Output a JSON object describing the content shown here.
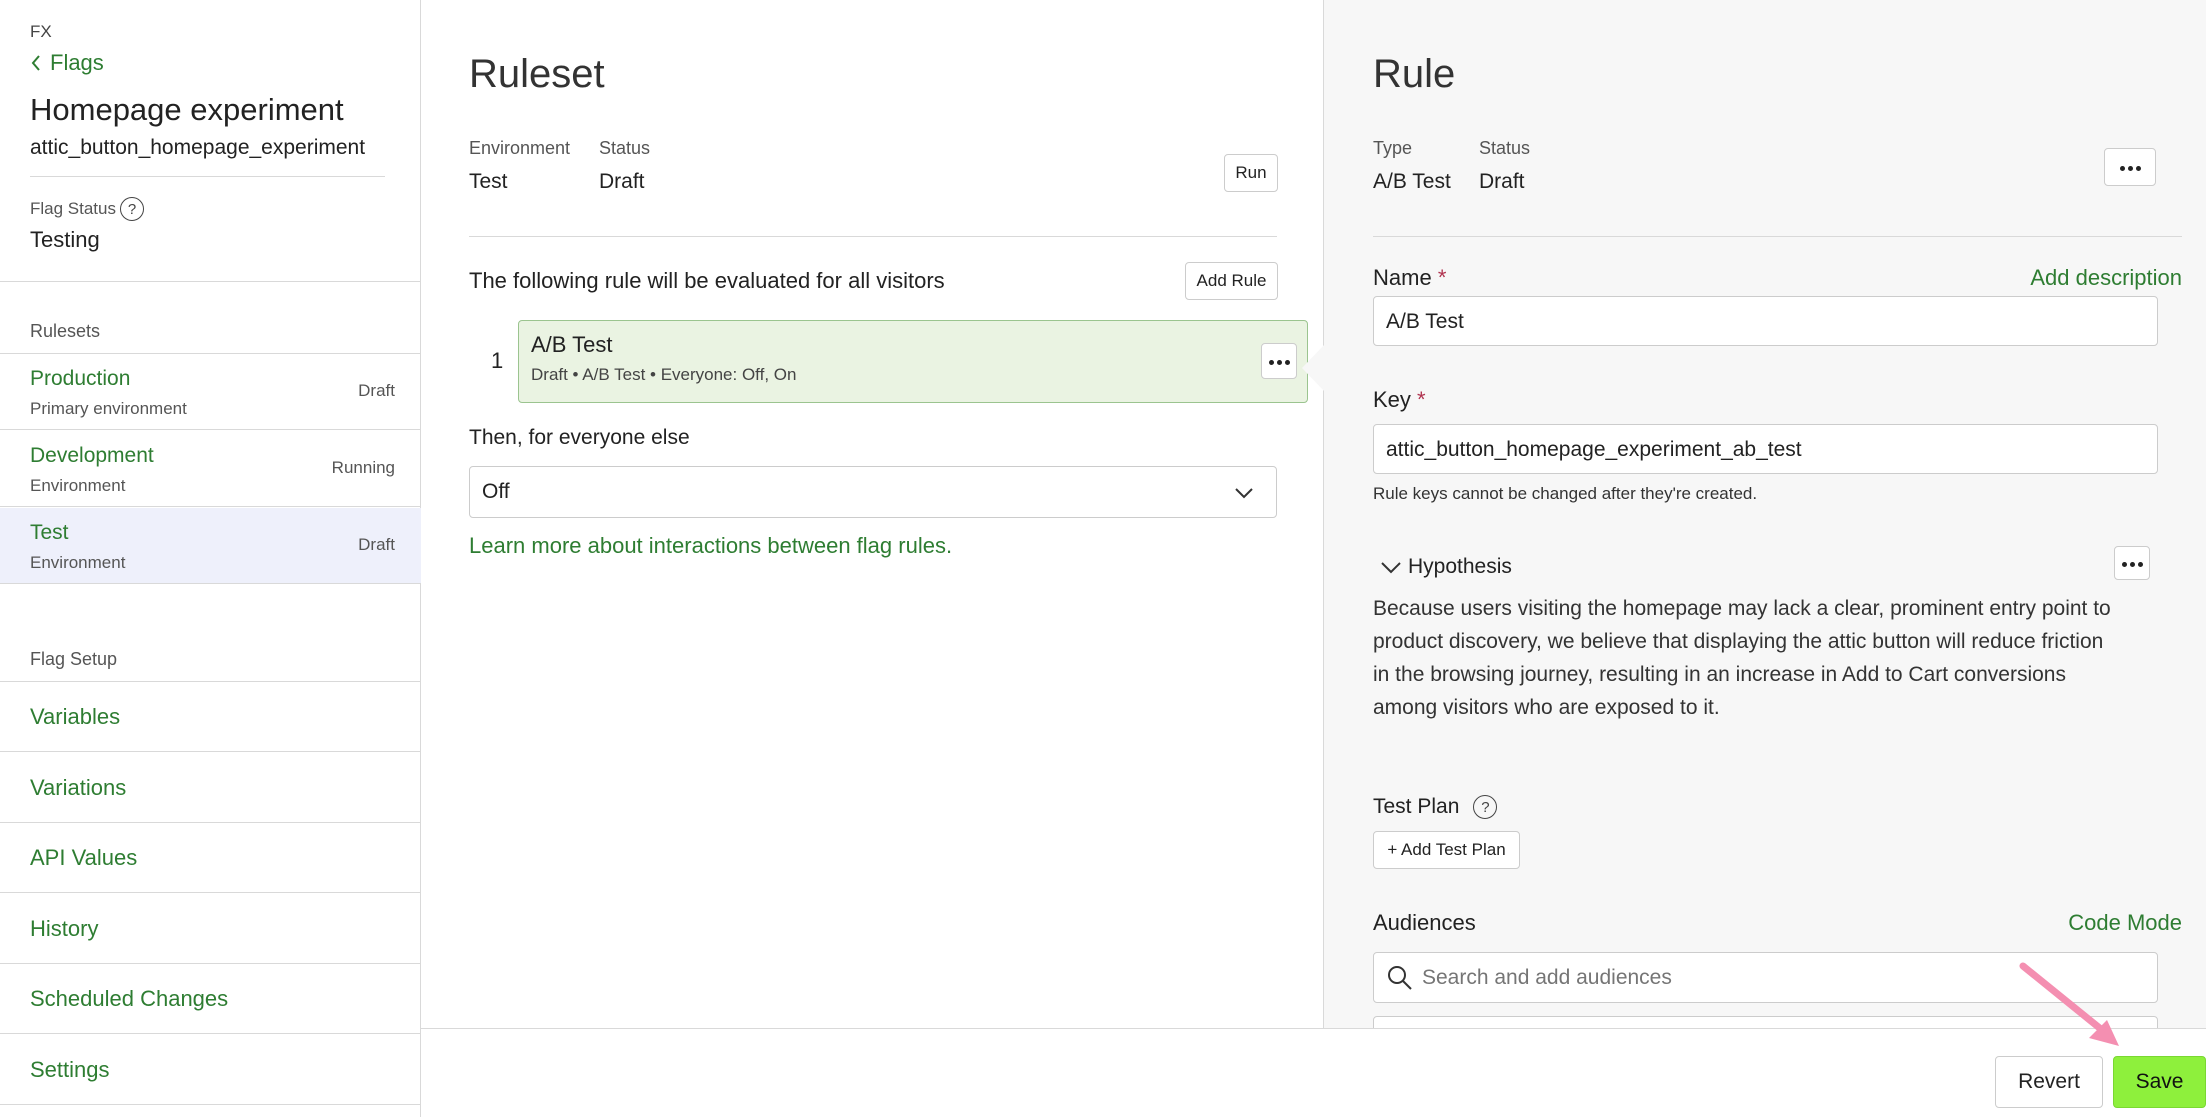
{
  "sidebar": {
    "crumb": "FX",
    "back_label": "Flags",
    "flag_title": "Homepage experiment",
    "flag_key": "attic_button_homepage_experiment",
    "flag_status_label": "Flag Status",
    "flag_status_value": "Testing",
    "rulesets_heading": "Rulesets",
    "rulesets": [
      {
        "name": "Production",
        "sub": "Primary environment",
        "status": "Draft"
      },
      {
        "name": "Development",
        "sub": "Environment",
        "status": "Running"
      },
      {
        "name": "Test",
        "sub": "Environment",
        "status": "Draft"
      }
    ],
    "setup_heading": "Flag Setup",
    "setup_items": [
      "Variables",
      "Variations",
      "API Values",
      "History",
      "Scheduled Changes",
      "Settings"
    ]
  },
  "ruleset": {
    "title": "Ruleset",
    "environment_label": "Environment",
    "environment_value": "Test",
    "status_label": "Status",
    "status_value": "Draft",
    "run_label": "Run",
    "evaluation_text": "The following rule will be evaluated for all visitors",
    "add_rule_label": "Add Rule",
    "rule_index": "1",
    "rule_title": "A/B Test",
    "rule_sub": "Draft • A/B Test • Everyone: Off, On",
    "else_label": "Then, for everyone else",
    "else_value": "Off",
    "learn_more": "Learn more about interactions between flag rules."
  },
  "rule": {
    "title": "Rule",
    "type_label": "Type",
    "type_value": "A/B Test",
    "status_label": "Status",
    "status_value": "Draft",
    "name_label": "Name",
    "required_mark": "*",
    "add_description": "Add description",
    "name_value": "A/B Test",
    "key_label": "Key",
    "key_value": "attic_button_homepage_experiment_ab_test",
    "key_hint": "Rule keys cannot be changed after they're created.",
    "hypothesis_label": "Hypothesis",
    "hypothesis_text": "Because users visiting the homepage may lack a clear, prominent entry point to product discovery, we believe that displaying the attic button will reduce friction in the browsing journey, resulting in an increase in Add to Cart conversions among visitors who are exposed to it.",
    "test_plan_label": "Test Plan",
    "add_test_plan_label": "+ Add Test Plan",
    "audiences_label": "Audiences",
    "code_mode_label": "Code Mode",
    "audience_search_placeholder": "Search and add audiences"
  },
  "footer": {
    "revert_label": "Revert",
    "save_label": "Save"
  },
  "help_glyph": "?",
  "colors": {
    "accent_green": "#2e7d32",
    "save_green": "#8ef03c",
    "active_row": "#eef0fb",
    "rule_card_bg": "#eaf3e2",
    "annotation_arrow": "#f48fb1"
  }
}
